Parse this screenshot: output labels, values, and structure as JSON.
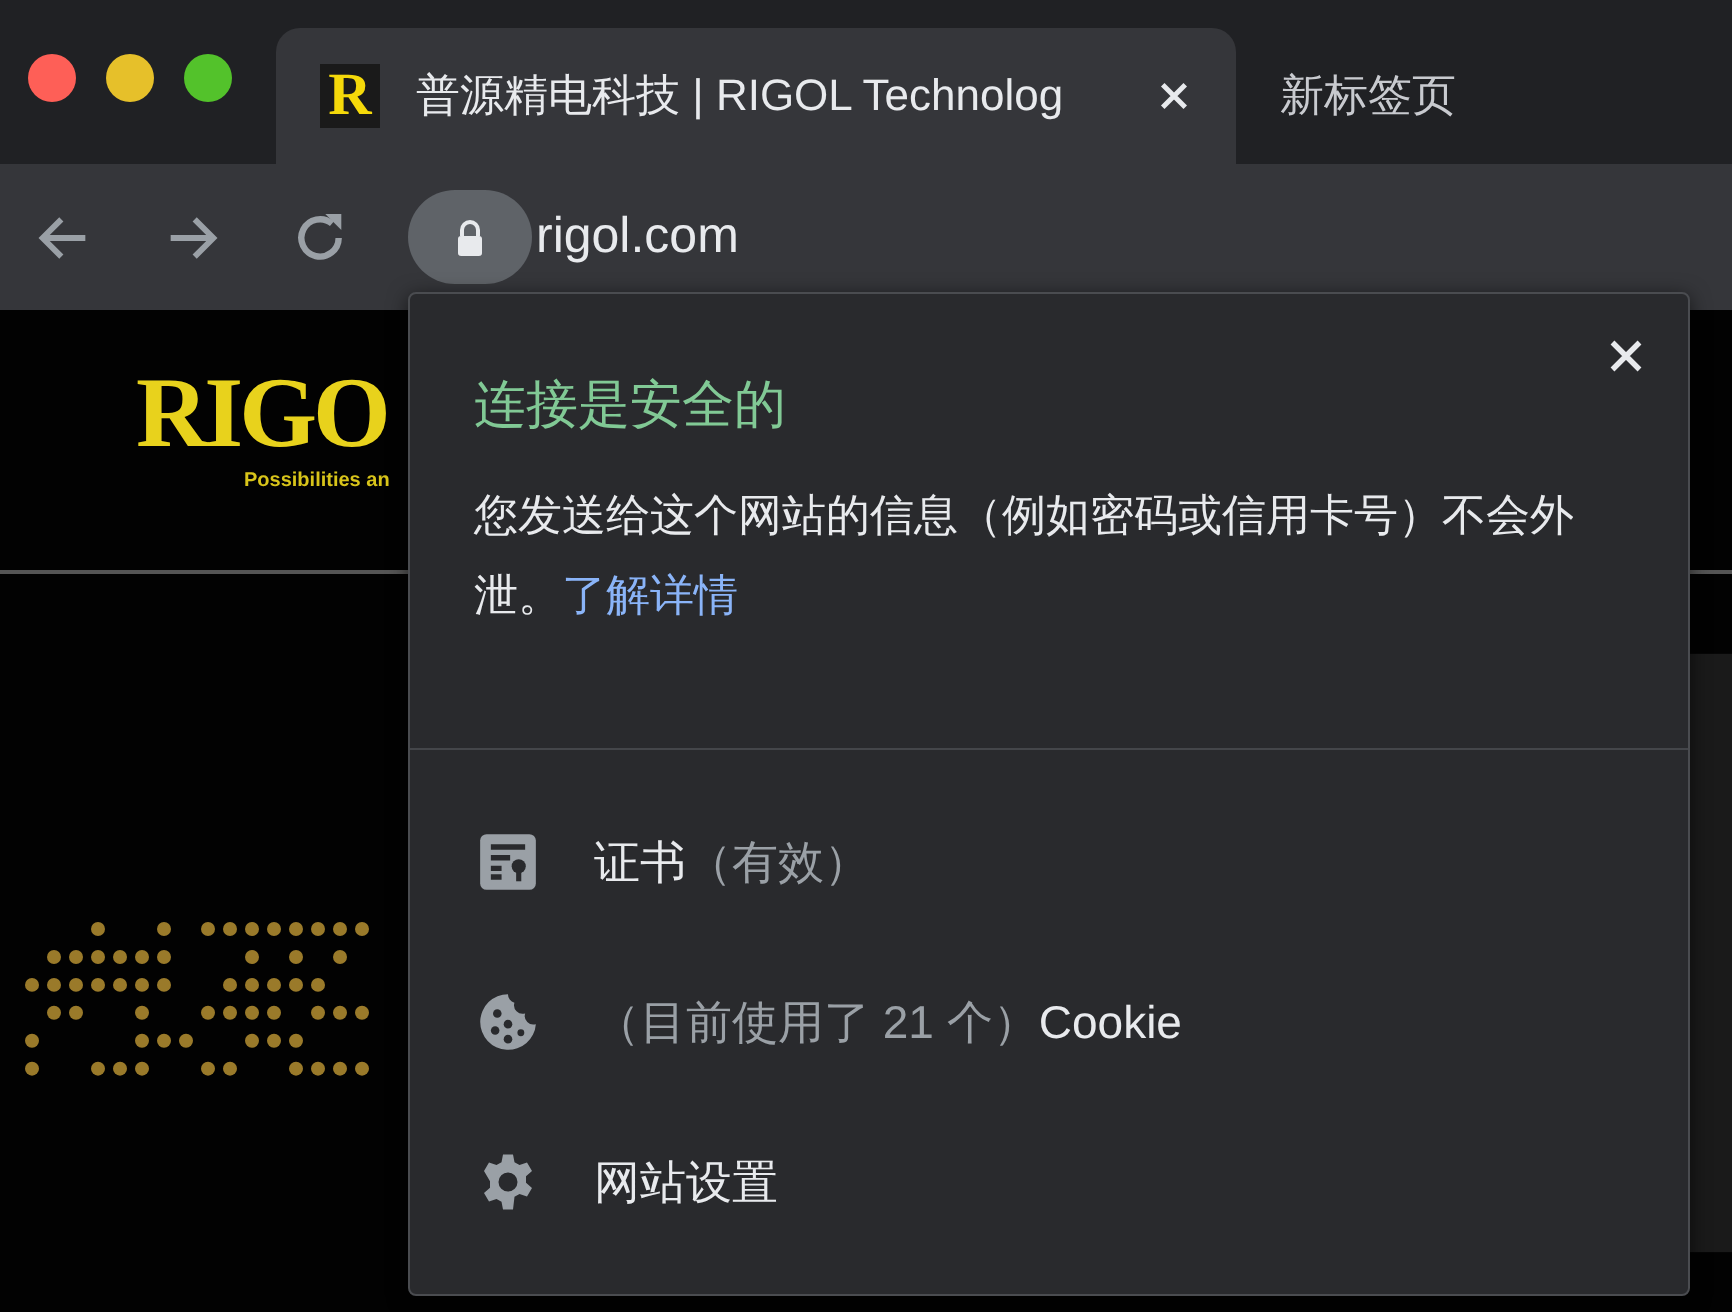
{
  "tabs": [
    {
      "title": "普源精电科技 | RIGOL Technolog",
      "favicon": "R",
      "selected": true
    },
    {
      "title": "新标签页",
      "selected": false
    }
  ],
  "address_bar": {
    "url": "rigol.com",
    "secure": true
  },
  "page": {
    "logo": "RIGO",
    "tagline": "Possibilities an"
  },
  "popup": {
    "title": "连接是安全的",
    "message": "您发送给这个网站的信息（例如密码或信用卡号）不会外泄。",
    "link": "了解详情",
    "items": [
      {
        "kind": "certificate",
        "parts": [
          {
            "text": "证书",
            "muted": false
          },
          {
            "text": "（有效）",
            "muted": true
          }
        ]
      },
      {
        "kind": "cookies",
        "parts": [
          {
            "text": "（目前使用了 21 个）",
            "muted": true
          },
          {
            "text": "Cookie",
            "muted": false
          }
        ]
      },
      {
        "kind": "settings",
        "parts": [
          {
            "text": "网站设置",
            "muted": false
          }
        ]
      }
    ]
  }
}
